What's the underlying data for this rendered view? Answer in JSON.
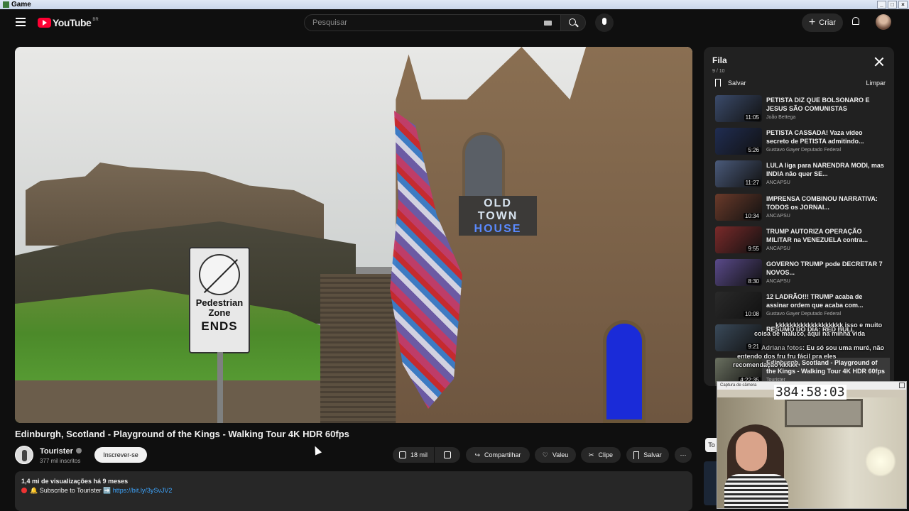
{
  "window": {
    "title": "Game"
  },
  "header": {
    "logo_text": "YouTube",
    "logo_country": "BR",
    "search_placeholder": "Pesquisar",
    "create_label": "Criar"
  },
  "video": {
    "title": "Edinburgh, Scotland - Playground of the Kings - Walking Tour 4K HDR 60fps",
    "sign_line1": "Pedestrian",
    "sign_line2": "Zone",
    "sign_line3": "ENDS",
    "building_sign_1": "OLD",
    "building_sign_2": "TOWN",
    "building_sign_3": "HOUSE"
  },
  "channel": {
    "name": "Tourister",
    "subscribers": "377 mil inscritos",
    "subscribe_label": "Inscrever-se"
  },
  "actions": {
    "like_count": "18 mil",
    "share": "Compartilhar",
    "thanks": "Valeu",
    "clip": "Clipe",
    "save": "Salvar"
  },
  "description": {
    "stats": "1,4 mi de visualizações  há 9 meses",
    "line1_prefix": "🔔 Subscribe to Tourister ➡️ ",
    "line1_link": "https://bit.ly/3ySvJV2"
  },
  "queue": {
    "title": "Fila",
    "count": "9 / 10",
    "save_label": "Salvar",
    "clear_label": "Limpar",
    "items": [
      {
        "title": "PETISTA DIZ QUE BOLSONARO E JESUS SÃO COMUNISTAS",
        "channel": "João Bettega",
        "duration": "11:05",
        "thumb_color": "#3b4b6b"
      },
      {
        "title": "PETISTA CASSADA! Vaza vídeo secreto de PETISTA admitindo...",
        "channel": "Gustavo Gayer Deputado Federal",
        "duration": "5:26",
        "thumb_color": "#202d52"
      },
      {
        "title": "LULA liga para NARENDRA MODI, mas INDIA não quer SE...",
        "channel": "ANCAPSU",
        "duration": "11:27",
        "thumb_color": "#4a5a7a"
      },
      {
        "title": "IMPRENSA COMBINOU NARRATIVA: TODOS os JORNAI...",
        "channel": "ANCAPSU",
        "duration": "10:34",
        "thumb_color": "#6a3a2a"
      },
      {
        "title": "TRUMP AUTORIZA OPERAÇÃO MILITAR na VENEZUELA contra...",
        "channel": "ANCAPSU",
        "duration": "9:55",
        "thumb_color": "#7a2a2a"
      },
      {
        "title": "GOVERNO TRUMP pode DECRETAR 7 NOVOS...",
        "channel": "ANCAPSU",
        "duration": "8:30",
        "thumb_color": "#5a4a8a"
      },
      {
        "title": "12 LADRÃO!!! TRUMP acaba de assinar ordem que acaba com...",
        "channel": "Gustavo Gayer Deputado Federal",
        "duration": "10:08",
        "thumb_color": "#2a2a2a"
      },
      {
        "title": "RESUMO DO DIA: RED BULL",
        "channel": "",
        "duration": "9:21",
        "thumb_color": "#3a4a5a"
      },
      {
        "title": "Edinburgh, Scotland - Playground of the Kings - Walking Tour 4K HDR 60fps",
        "channel": "Tourister",
        "duration": "4:22:35",
        "thumb_color": "#6a7060"
      }
    ]
  },
  "chat_overlay": {
    "line1": "kkkkkkkkkkkkkkkkkkk isso e muito",
    "line2": "coisa de maluco, aqui na minha vida",
    "line3_name": "Adriana fotos",
    "line3": ": Eu só sou uma muré, não",
    "line4": "entendo dos fru fru fácil pra eles",
    "line5": "recomendação kkkkk"
  },
  "webcam": {
    "timer": "384:58:03",
    "bar_label": "Captura de câmera"
  },
  "side_chip": "To"
}
